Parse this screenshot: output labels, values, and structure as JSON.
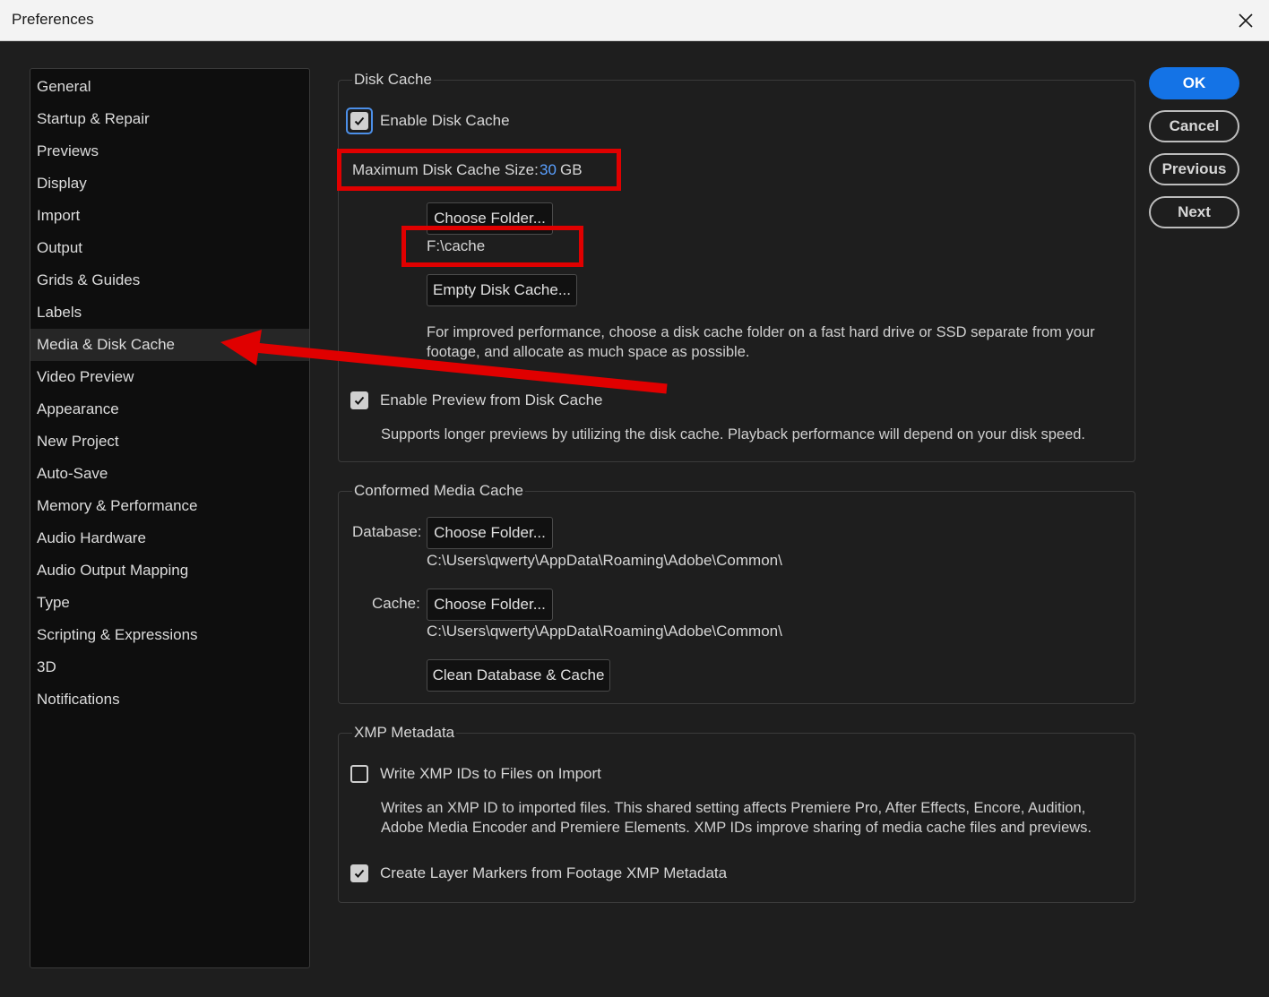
{
  "window": {
    "title": "Preferences"
  },
  "sidebar": {
    "items": [
      {
        "label": "General"
      },
      {
        "label": "Startup & Repair"
      },
      {
        "label": "Previews"
      },
      {
        "label": "Display"
      },
      {
        "label": "Import"
      },
      {
        "label": "Output"
      },
      {
        "label": "Grids & Guides"
      },
      {
        "label": "Labels"
      },
      {
        "label": "Media & Disk Cache",
        "selected": true
      },
      {
        "label": "Video Preview"
      },
      {
        "label": "Appearance"
      },
      {
        "label": "New Project"
      },
      {
        "label": "Auto-Save"
      },
      {
        "label": "Memory & Performance"
      },
      {
        "label": "Audio Hardware"
      },
      {
        "label": "Audio Output Mapping"
      },
      {
        "label": "Type"
      },
      {
        "label": "Scripting & Expressions"
      },
      {
        "label": "3D"
      },
      {
        "label": "Notifications"
      }
    ]
  },
  "disk_cache": {
    "title": "Disk Cache",
    "enable_label": "Enable Disk Cache",
    "enable_checked": true,
    "max_size_label": "Maximum Disk Cache Size:",
    "max_size_value": "30",
    "max_size_unit": "GB",
    "choose_folder": "Choose Folder...",
    "folder_path": "F:\\cache",
    "empty_cache": "Empty Disk Cache...",
    "description": "For improved performance, choose a disk cache folder on a fast hard drive or SSD separate from your footage, and allocate as much space as possible.",
    "preview_label": "Enable Preview from Disk Cache",
    "preview_checked": true,
    "preview_description": "Supports longer previews by utilizing the disk cache. Playback performance will depend on your disk speed."
  },
  "conformed": {
    "title": "Conformed Media Cache",
    "database_label": "Database:",
    "database_button": "Choose Folder...",
    "database_path": "C:\\Users\\qwerty\\AppData\\Roaming\\Adobe\\Common\\",
    "cache_label": "Cache:",
    "cache_button": "Choose Folder...",
    "cache_path": "C:\\Users\\qwerty\\AppData\\Roaming\\Adobe\\Common\\",
    "clean_button": "Clean Database & Cache"
  },
  "xmp": {
    "title": "XMP Metadata",
    "write_label": "Write XMP IDs to Files on Import",
    "write_checked": false,
    "write_description": "Writes an XMP ID to imported files. This shared setting affects Premiere Pro, After Effects, Encore, Audition, Adobe Media Encoder and Premiere Elements. XMP IDs improve sharing of media cache files and previews.",
    "markers_label": "Create Layer Markers from Footage XMP Metadata",
    "markers_checked": true
  },
  "buttons": {
    "ok": "OK",
    "cancel": "Cancel",
    "previous": "Previous",
    "next": "Next"
  },
  "colors": {
    "accent": "#1473e6",
    "annotation": "#e00000",
    "value": "#5aa0ff"
  }
}
